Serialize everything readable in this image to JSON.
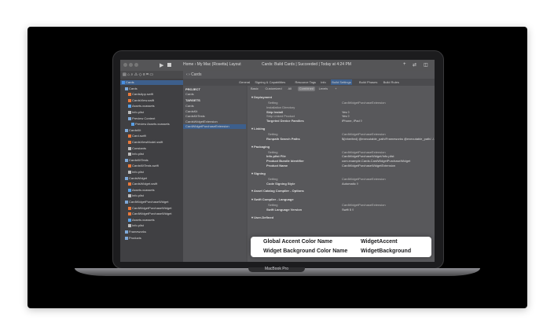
{
  "laptop": {
    "model_label": "MacBook Pro"
  },
  "toolbar": {
    "run_icon": "▶",
    "scheme": "Home  ›  My Mac (Rosetta)  Layout",
    "status": "Cards: Build Cards | Succeeded  |  Today at 4:24 PM",
    "icons": [
      "+",
      "⇄",
      "◫"
    ]
  },
  "navigator": {
    "filter_icons": "▤ ⌂ ⌕ ⚠ ◇ ≡ ⌗ ▭",
    "items": [
      {
        "label": "Cards",
        "indent": 0,
        "kind": "project",
        "selected": true
      },
      {
        "label": "Cards",
        "indent": 1,
        "kind": "folder"
      },
      {
        "label": "CardsApp.swift",
        "indent": 2,
        "kind": "swift"
      },
      {
        "label": "CardsView.swift",
        "indent": 2,
        "kind": "swift"
      },
      {
        "label": "Assets.xcassets",
        "indent": 2,
        "kind": "asset"
      },
      {
        "label": "Info.plist",
        "indent": 2,
        "kind": "file"
      },
      {
        "label": "Preview Content",
        "indent": 2,
        "kind": "folder"
      },
      {
        "label": "Preview Assets.xcassets",
        "indent": 3,
        "kind": "asset"
      },
      {
        "label": "CardsKit",
        "indent": 1,
        "kind": "folder"
      },
      {
        "label": "Card.swift",
        "indent": 2,
        "kind": "swift"
      },
      {
        "label": "CardsViewModel.swift",
        "indent": 2,
        "kind": "swift"
      },
      {
        "label": "Constants",
        "indent": 2,
        "kind": "file"
      },
      {
        "label": "Info.plist",
        "indent": 2,
        "kind": "file"
      },
      {
        "label": "CardsKitTests",
        "indent": 1,
        "kind": "folder"
      },
      {
        "label": "CardsKitTests.swift",
        "indent": 2,
        "kind": "swift"
      },
      {
        "label": "Info.plist",
        "indent": 2,
        "kind": "file"
      },
      {
        "label": "CardsWidget",
        "indent": 1,
        "kind": "folder"
      },
      {
        "label": "CardsWidget.swift",
        "indent": 2,
        "kind": "swift"
      },
      {
        "label": "Assets.xcassets",
        "indent": 2,
        "kind": "asset"
      },
      {
        "label": "Info.plist",
        "indent": 2,
        "kind": "file"
      },
      {
        "label": "CardWidgetPurchaseWidget",
        "indent": 1,
        "kind": "folder"
      },
      {
        "label": "CardWidgetPurchaseWidget",
        "indent": 2,
        "kind": "swift"
      },
      {
        "label": "CardWidgetPurchaseWidget",
        "indent": 2,
        "kind": "swift"
      },
      {
        "label": "Assets.xcassets",
        "indent": 2,
        "kind": "asset"
      },
      {
        "label": "Info.plist",
        "indent": 2,
        "kind": "file"
      },
      {
        "label": "Frameworks",
        "indent": 1,
        "kind": "folder"
      },
      {
        "label": "Products",
        "indent": 1,
        "kind": "folder"
      }
    ]
  },
  "editor": {
    "jump_bar": "‹  ›  Cards",
    "tabs": [
      {
        "label": "General",
        "selected": false
      },
      {
        "label": "Signing & Capabilities",
        "selected": false
      },
      {
        "label": "Resource Tags",
        "selected": false
      },
      {
        "label": "Info",
        "selected": false
      },
      {
        "label": "Build Settings",
        "selected": true
      },
      {
        "label": "Build Phases",
        "selected": false
      },
      {
        "label": "Build Rules",
        "selected": false
      }
    ],
    "project_header": "PROJECT",
    "project_items": [
      "Cards"
    ],
    "targets_header": "TARGETS",
    "target_items": [
      {
        "label": "Cards",
        "selected": false
      },
      {
        "label": "CardsKit",
        "selected": false
      },
      {
        "label": "CardsKitTests",
        "selected": false
      },
      {
        "label": "CardsWidgetExtension",
        "selected": false
      },
      {
        "label": "CardWidgetPurchaseExtension",
        "selected": true
      }
    ],
    "filters": [
      {
        "label": "Basic",
        "selected": false
      },
      {
        "label": "Customized",
        "selected": false
      },
      {
        "label": "All",
        "selected": false
      },
      {
        "label": "Combined",
        "selected": true
      },
      {
        "label": "Levels",
        "selected": false
      },
      {
        "label": "+",
        "selected": false
      }
    ],
    "sections": [
      {
        "title": "▾ Deployment",
        "rows": [
          {
            "key": "Setting",
            "value": "CardWidgetPurchaseExtension",
            "header": true
          },
          {
            "key": "Installation Directory",
            "value": ""
          },
          {
            "key": "Skip Install",
            "value": "Yes ◊",
            "bold": true
          },
          {
            "key": "Strip Linked Product",
            "value": "Yes ◊"
          },
          {
            "key": "Targeted Device Families",
            "value": "iPhone, iPad ◊",
            "bold": true
          }
        ]
      },
      {
        "title": "▾ Linking",
        "rows": [
          {
            "key": "Setting",
            "value": "CardWidgetPurchaseExtension",
            "header": true
          },
          {
            "key": "Runpath Search Paths",
            "value": "$(inherited) @executable_path/Frameworks @executable_path/../../...",
            "bold": true
          }
        ]
      },
      {
        "title": "▾ Packaging",
        "rows": [
          {
            "key": "Setting",
            "value": "CardWidgetPurchaseExtension",
            "header": true
          },
          {
            "key": "Info.plist File",
            "value": "CardWidgetPurchaseWidget/Info.plist",
            "bold": true
          },
          {
            "key": "Product Bundle Identifier",
            "value": "com.example.Cards.CardWidgetPurchaseWidget",
            "bold": true
          },
          {
            "key": "Product Name",
            "value": "CardWidgetPurchaseWidgetExtension",
            "bold": true
          }
        ]
      },
      {
        "title": "▾ Signing",
        "rows": [
          {
            "key": "Setting",
            "value": "CardWidgetPurchaseExtension",
            "header": true
          },
          {
            "key": "Code Signing Style",
            "value": "Automatic ◊",
            "bold": true
          }
        ]
      },
      {
        "title": "▾ Asset Catalog Compiler - Options",
        "rows": []
      },
      {
        "title": "▾ Swift Compiler - Language",
        "rows": [
          {
            "key": "Setting",
            "value": "CardWidgetPurchaseExtension",
            "header": true
          },
          {
            "key": "Swift Language Version",
            "value": "Swift 5 ◊",
            "bold": true
          }
        ]
      },
      {
        "title": "▾ User-Defined",
        "rows": []
      }
    ]
  },
  "popup": {
    "rows": [
      {
        "key": "Global Accent Color Name",
        "value": "WidgetAccent"
      },
      {
        "key": "Widget Background Color Name",
        "value": "WidgetBackground"
      }
    ]
  }
}
